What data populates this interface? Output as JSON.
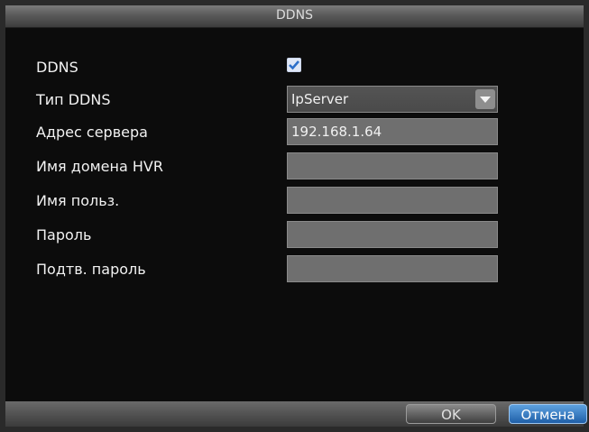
{
  "window": {
    "title": "DDNS"
  },
  "form": {
    "ddns": {
      "label": "DDNS",
      "checked": true
    },
    "ddns_type": {
      "label": "Тип DDNS",
      "value": "IpServer"
    },
    "server_address": {
      "label": "Адрес сервера",
      "value": "192.168.1.64"
    },
    "hvr_domain_name": {
      "label": "Имя домена HVR",
      "value": ""
    },
    "username": {
      "label": "Имя польз.",
      "value": ""
    },
    "password": {
      "label": "Пароль",
      "value": ""
    },
    "confirm_password": {
      "label": "Подтв. пароль",
      "value": ""
    }
  },
  "buttons": {
    "ok_label": "OK",
    "cancel_label": "Отмена"
  },
  "icons": {
    "checkbox": "checkmark-icon",
    "dropdown": "chevron-down-icon"
  },
  "colors": {
    "accent": "#2f78c4",
    "field": "#6f6f6f",
    "background": "#0c0c0c"
  }
}
